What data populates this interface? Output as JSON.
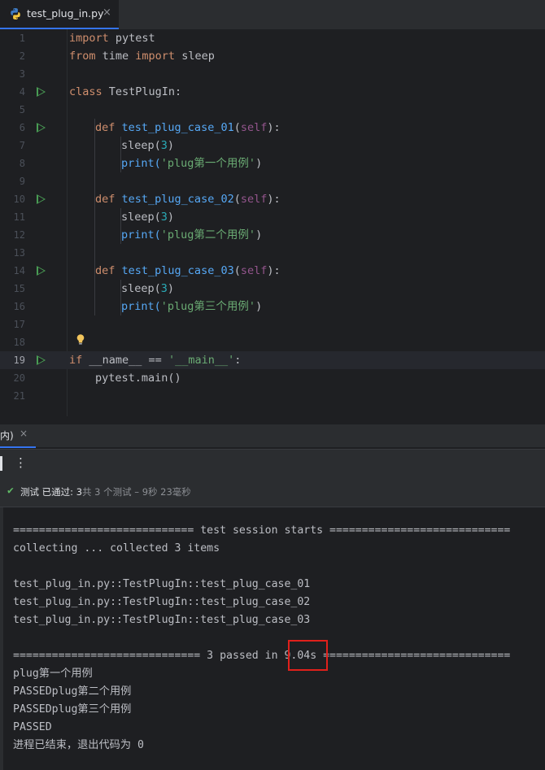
{
  "tab": {
    "filename": "test_plug_in.py",
    "close": "×"
  },
  "editor": {
    "line_numbers": [
      "1",
      "2",
      "3",
      "4",
      "5",
      "6",
      "7",
      "8",
      "9",
      "10",
      "11",
      "12",
      "13",
      "14",
      "15",
      "16",
      "17",
      "18",
      "19",
      "20",
      "21"
    ],
    "code": {
      "l1_kw": "import",
      "l1_rest": " pytest",
      "l2_kw1": "from",
      "l2_mid": " time ",
      "l2_kw2": "import",
      "l2_rest": " sleep",
      "l4_kw": "class",
      "l4_rest": " TestPlugIn:",
      "l6_kw": "def",
      "l6_fn": "test_plug_case_01",
      "l6_self": "self",
      "l10_kw": "def",
      "l10_fn": "test_plug_case_02",
      "l10_self": "self",
      "l14_kw": "def",
      "l14_fn": "test_plug_case_03",
      "l14_self": "self",
      "sleep_call": "sleep(",
      "sleep_arg": "3",
      "close_paren": ")",
      "print_call": "print(",
      "str1": "'plug第一个用例'",
      "str2": "'plug第二个用例'",
      "str3": "'plug第三个用例'",
      "open_paren": "(",
      "close_colon": "):",
      "l19_kw": "if",
      "l19_mid": " __name__ == ",
      "l19_str": "'__main__'",
      "l19_end": ":",
      "l20": "pytest.main()"
    }
  },
  "run_panel": {
    "tab_label": "内)",
    "tab_close": "×",
    "more_icon": "⋮",
    "status_label": "测试 已通过: ",
    "status_count": "3",
    "status_detail": "共 3 个测试 – 9秒 23毫秒"
  },
  "console": {
    "lines": [
      "============================ test session starts ============================",
      "collecting ... collected 3 items",
      "",
      "test_plug_in.py::TestPlugIn::test_plug_case_01",
      "test_plug_in.py::TestPlugIn::test_plug_case_02",
      "test_plug_in.py::TestPlugIn::test_plug_case_03",
      "",
      "============================= 3 passed in 9.04s =============================",
      "plug第一个用例",
      "PASSEDplug第二个用例",
      "PASSEDplug第三个用例",
      "PASSED",
      "进程已结束，退出代码为 0"
    ]
  },
  "colors": {
    "accent": "#3574f0",
    "run_green": "#499c54",
    "highlight_red": "#e0201b"
  }
}
